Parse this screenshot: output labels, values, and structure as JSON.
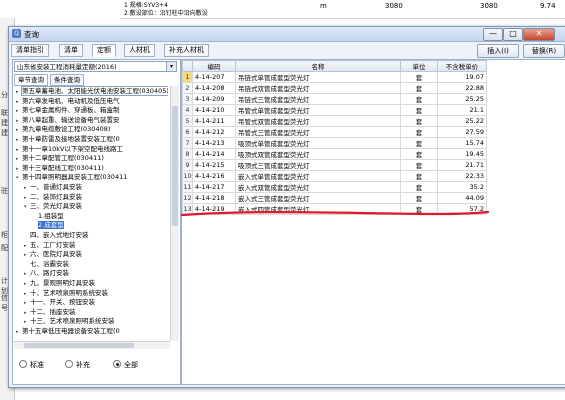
{
  "background": {
    "row1": {
      "line1": "1 规格:SYV3+4",
      "line2": "2 敷设部位：沿钉柱中沿向敷设",
      "unit": "m",
      "qty1": "3080",
      "qty2": "3080",
      "price": "9.74"
    },
    "left_fragments": [
      "分",
      "联",
      "建",
      "建",
      "驻",
      "柜",
      "配",
      "计划",
      "信号"
    ]
  },
  "dialog": {
    "title": "查询",
    "close_glyph": "✕",
    "min_glyph": "—",
    "max_glyph": "□"
  },
  "toolbar": {
    "tabs": [
      "清单指引",
      "清单",
      "定额",
      "人材机",
      "补充人材机"
    ],
    "active_tab": "定额",
    "insert_label": "插入(I)",
    "replace_label": "替换(R)"
  },
  "left": {
    "quota_set": "山东省安装工程消耗量定额(2016)",
    "subtabs": [
      "章节查询",
      "条件查询"
    ],
    "active_subtab": "章节查询",
    "tree": [
      {
        "label": "第五章蓄电池、太阳能光伏电池安装工程(030405)",
        "level": 0,
        "toggle": "▸",
        "hi": true
      },
      {
        "label": "第六章发电机、电动机及低压电气",
        "level": 0,
        "toggle": "▸"
      },
      {
        "label": "第七章金属构件、穿通板、箱盒制",
        "level": 0,
        "toggle": "▸"
      },
      {
        "label": "第八章起重、输送设备电气装置安",
        "level": 0,
        "toggle": "▸"
      },
      {
        "label": "第九章电缆敷设工程(030408)",
        "level": 0,
        "toggle": "▸"
      },
      {
        "label": "第十章防雷及接地装置安装工程(0",
        "level": 0,
        "toggle": "▸"
      },
      {
        "label": "第十一章10kV以下架空配电线路工",
        "level": 0,
        "toggle": "▸"
      },
      {
        "label": "第十二章配管工程(030411)",
        "level": 0,
        "toggle": "▸"
      },
      {
        "label": "第十三章配线工程(030411)",
        "level": 0,
        "toggle": "▸"
      },
      {
        "label": "第十四章照明器具安装工程(030411",
        "level": 0,
        "toggle": "▾"
      },
      {
        "label": "一、普通灯具安装",
        "level": 1,
        "toggle": "▸"
      },
      {
        "label": "二、装饰灯具安装",
        "level": 1,
        "toggle": "▸"
      },
      {
        "label": "三、荧光灯具安装",
        "level": 1,
        "toggle": "▾"
      },
      {
        "label": "1.组装型",
        "level": 2,
        "toggle": ""
      },
      {
        "label": "2.成套型",
        "level": 2,
        "toggle": "",
        "sel": true
      },
      {
        "label": "四、嵌入式地灯安装",
        "level": 1,
        "toggle": ""
      },
      {
        "label": "五、工厂灯安装",
        "level": 1,
        "toggle": "▸"
      },
      {
        "label": "六、医院灯具安装",
        "level": 1,
        "toggle": "▸"
      },
      {
        "label": "七、浴霸安装",
        "level": 1,
        "toggle": ""
      },
      {
        "label": "八、路灯安装",
        "level": 1,
        "toggle": "▸"
      },
      {
        "label": "九、景观照明灯具安装",
        "level": 1,
        "toggle": "▸"
      },
      {
        "label": "十、艺术喷泉照明系统安装",
        "level": 1,
        "toggle": "▸"
      },
      {
        "label": "十一、开关、按钮安装",
        "level": 1,
        "toggle": "▸"
      },
      {
        "label": "十二、插座安装",
        "level": 1,
        "toggle": "▸"
      },
      {
        "label": "十三、艺术喷泉照明系统安装",
        "level": 1,
        "toggle": "▸"
      },
      {
        "label": "第十五章低压电器设备安装工程(0",
        "level": 0,
        "toggle": "▸"
      }
    ],
    "filter_options": [
      "标准",
      "补充",
      "全部"
    ],
    "filter_selected": "全部"
  },
  "table": {
    "headers": [
      "",
      "编码",
      "名称",
      "单位",
      "不含税单价"
    ],
    "rows": [
      [
        "1",
        "4-14-207",
        "吊链式单管成套型荧光灯",
        "套",
        "19.07"
      ],
      [
        "2",
        "4-14-208",
        "吊链式双管成套型荧光灯",
        "套",
        "22.88"
      ],
      [
        "3",
        "4-14-209",
        "吊链式三管成套型荧光灯",
        "套",
        "25.25"
      ],
      [
        "4",
        "4-14-210",
        "吊管式单管成套型荧光灯",
        "套",
        "21.1"
      ],
      [
        "5",
        "4-14-211",
        "吊管式双管成套型荧光灯",
        "套",
        "25.22"
      ],
      [
        "6",
        "4-14-212",
        "吊管式三管成套型荧光灯",
        "套",
        "27.59"
      ],
      [
        "7",
        "4-14-213",
        "吸顶式单管成套型荧光灯",
        "套",
        "15.74"
      ],
      [
        "8",
        "4-14-214",
        "吸顶式双管成套型荧光灯",
        "套",
        "19.45"
      ],
      [
        "9",
        "4-14-215",
        "吸顶式三管成套型荧光灯",
        "套",
        "21.71"
      ],
      [
        "10",
        "4-14-216",
        "嵌入式单管成套型荧光灯",
        "套",
        "22.33"
      ],
      [
        "11",
        "4-14-217",
        "嵌入式双管成套型荧光灯",
        "套",
        "35.2"
      ],
      [
        "12",
        "4-14-218",
        "嵌入式三管成套型荧光灯",
        "套",
        "44.09"
      ],
      [
        "13",
        "4-14-219",
        "嵌入式四管成套型荧光灯",
        "套",
        "57.2"
      ]
    ],
    "selected_row": 1,
    "header_color": "#dfe6f0",
    "accent_red": "#e0192a"
  }
}
